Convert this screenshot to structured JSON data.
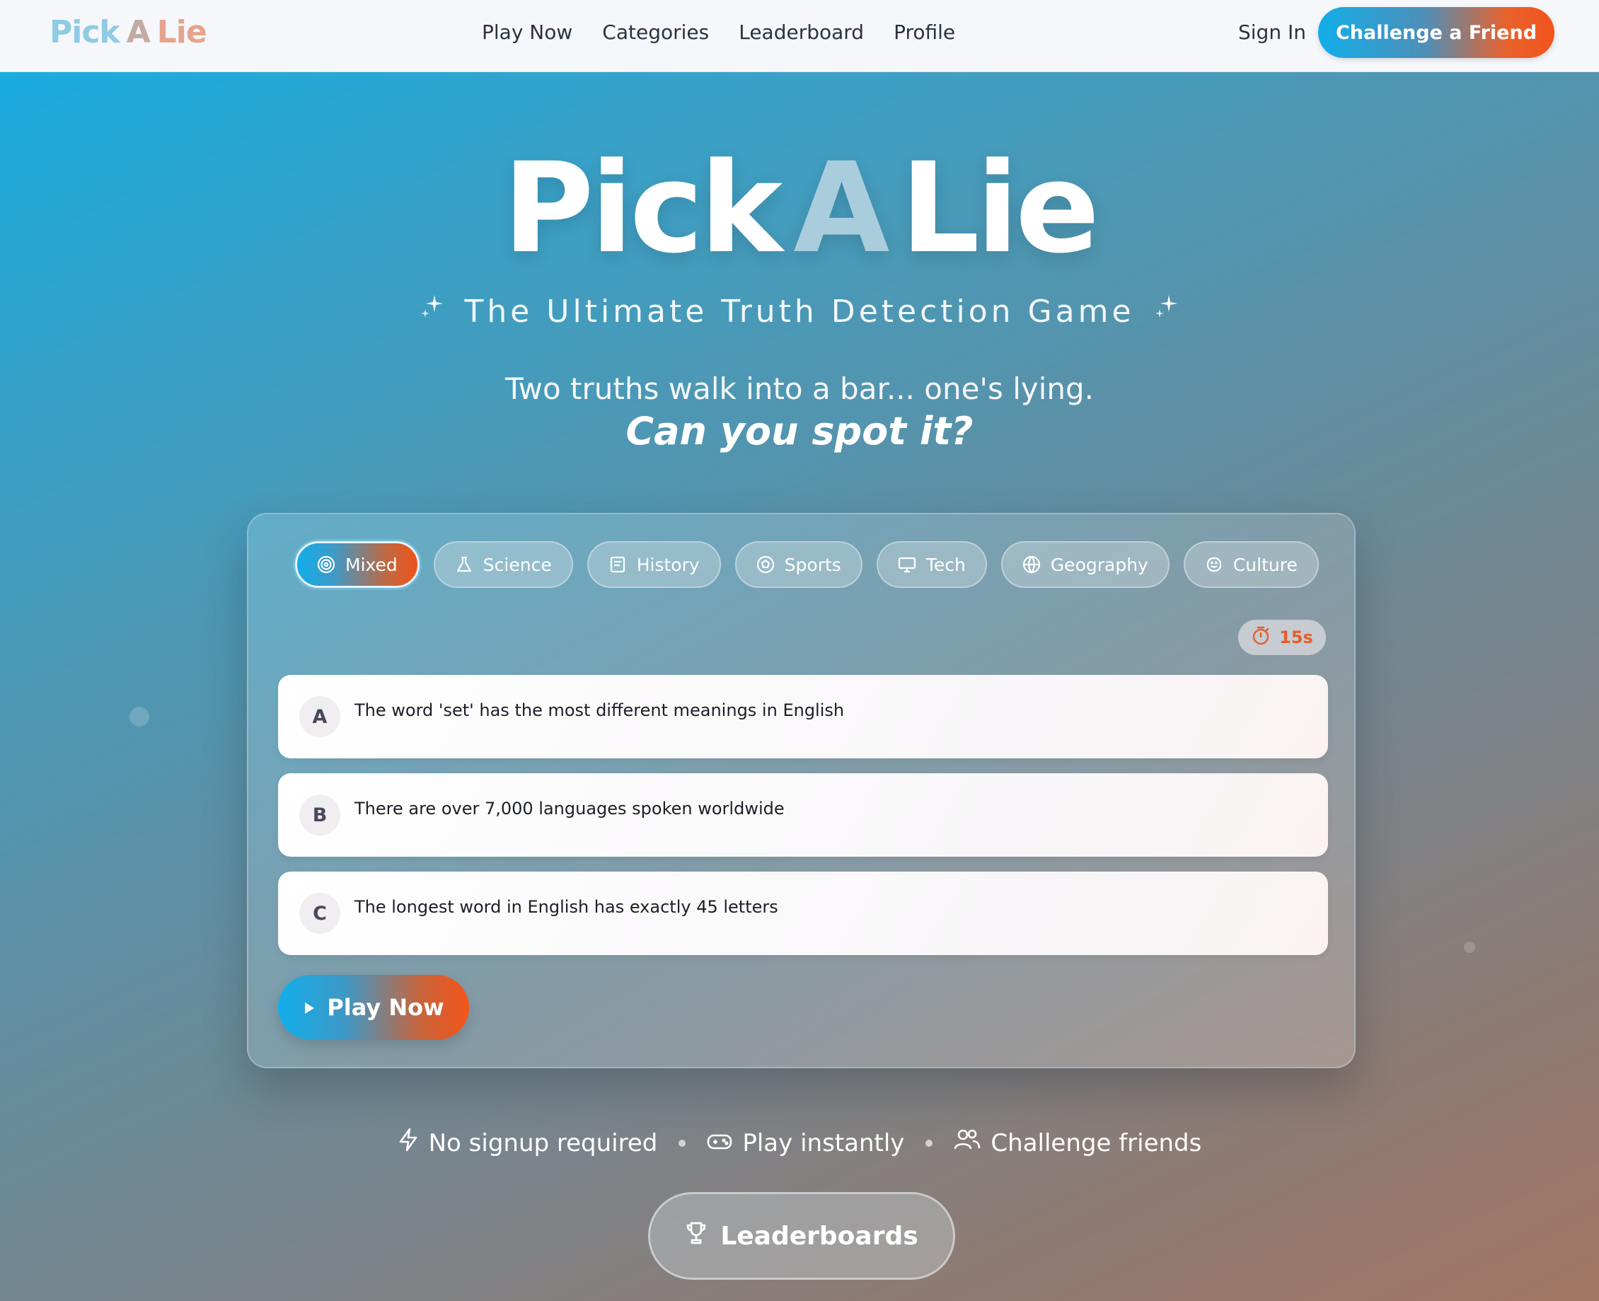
{
  "header": {
    "logo": [
      "Pick",
      "A",
      "Lie"
    ],
    "nav": [
      "Play Now",
      "Categories",
      "Leaderboard",
      "Profile"
    ],
    "sign_in": "Sign In",
    "challenge_button": "Challenge a Friend"
  },
  "hero": {
    "title_1": "Pick",
    "title_2": "A",
    "title_3": "Lie",
    "tagline": "The Ultimate Truth Detection Game",
    "subtitle": "Two truths walk into a bar... one's lying.",
    "question": "Can you spot it?"
  },
  "game": {
    "categories": [
      {
        "label": "Mixed",
        "icon": "target-icon",
        "active": true
      },
      {
        "label": "Science",
        "icon": "flask-icon",
        "active": false
      },
      {
        "label": "History",
        "icon": "book-icon",
        "active": false
      },
      {
        "label": "Sports",
        "icon": "ball-icon",
        "active": false
      },
      {
        "label": "Tech",
        "icon": "monitor-icon",
        "active": false
      },
      {
        "label": "Geography",
        "icon": "globe-icon",
        "active": false
      },
      {
        "label": "Culture",
        "icon": "smile-icon",
        "active": false
      }
    ],
    "timer": "15s",
    "options": [
      {
        "letter": "A",
        "text": "The word 'set' has the most different meanings in English"
      },
      {
        "letter": "B",
        "text": "There are over 7,000 languages spoken worldwide"
      },
      {
        "letter": "C",
        "text": "The longest word in English has exactly 45 letters"
      }
    ],
    "play_button": "Play Now"
  },
  "features": [
    "No signup required",
    "Play instantly",
    "Challenge friends"
  ],
  "leaderboards_button": "Leaderboards",
  "colors": {
    "accent_blue": "#12aeea",
    "accent_orange": "#f3541b",
    "timer": "#e35d2c"
  }
}
